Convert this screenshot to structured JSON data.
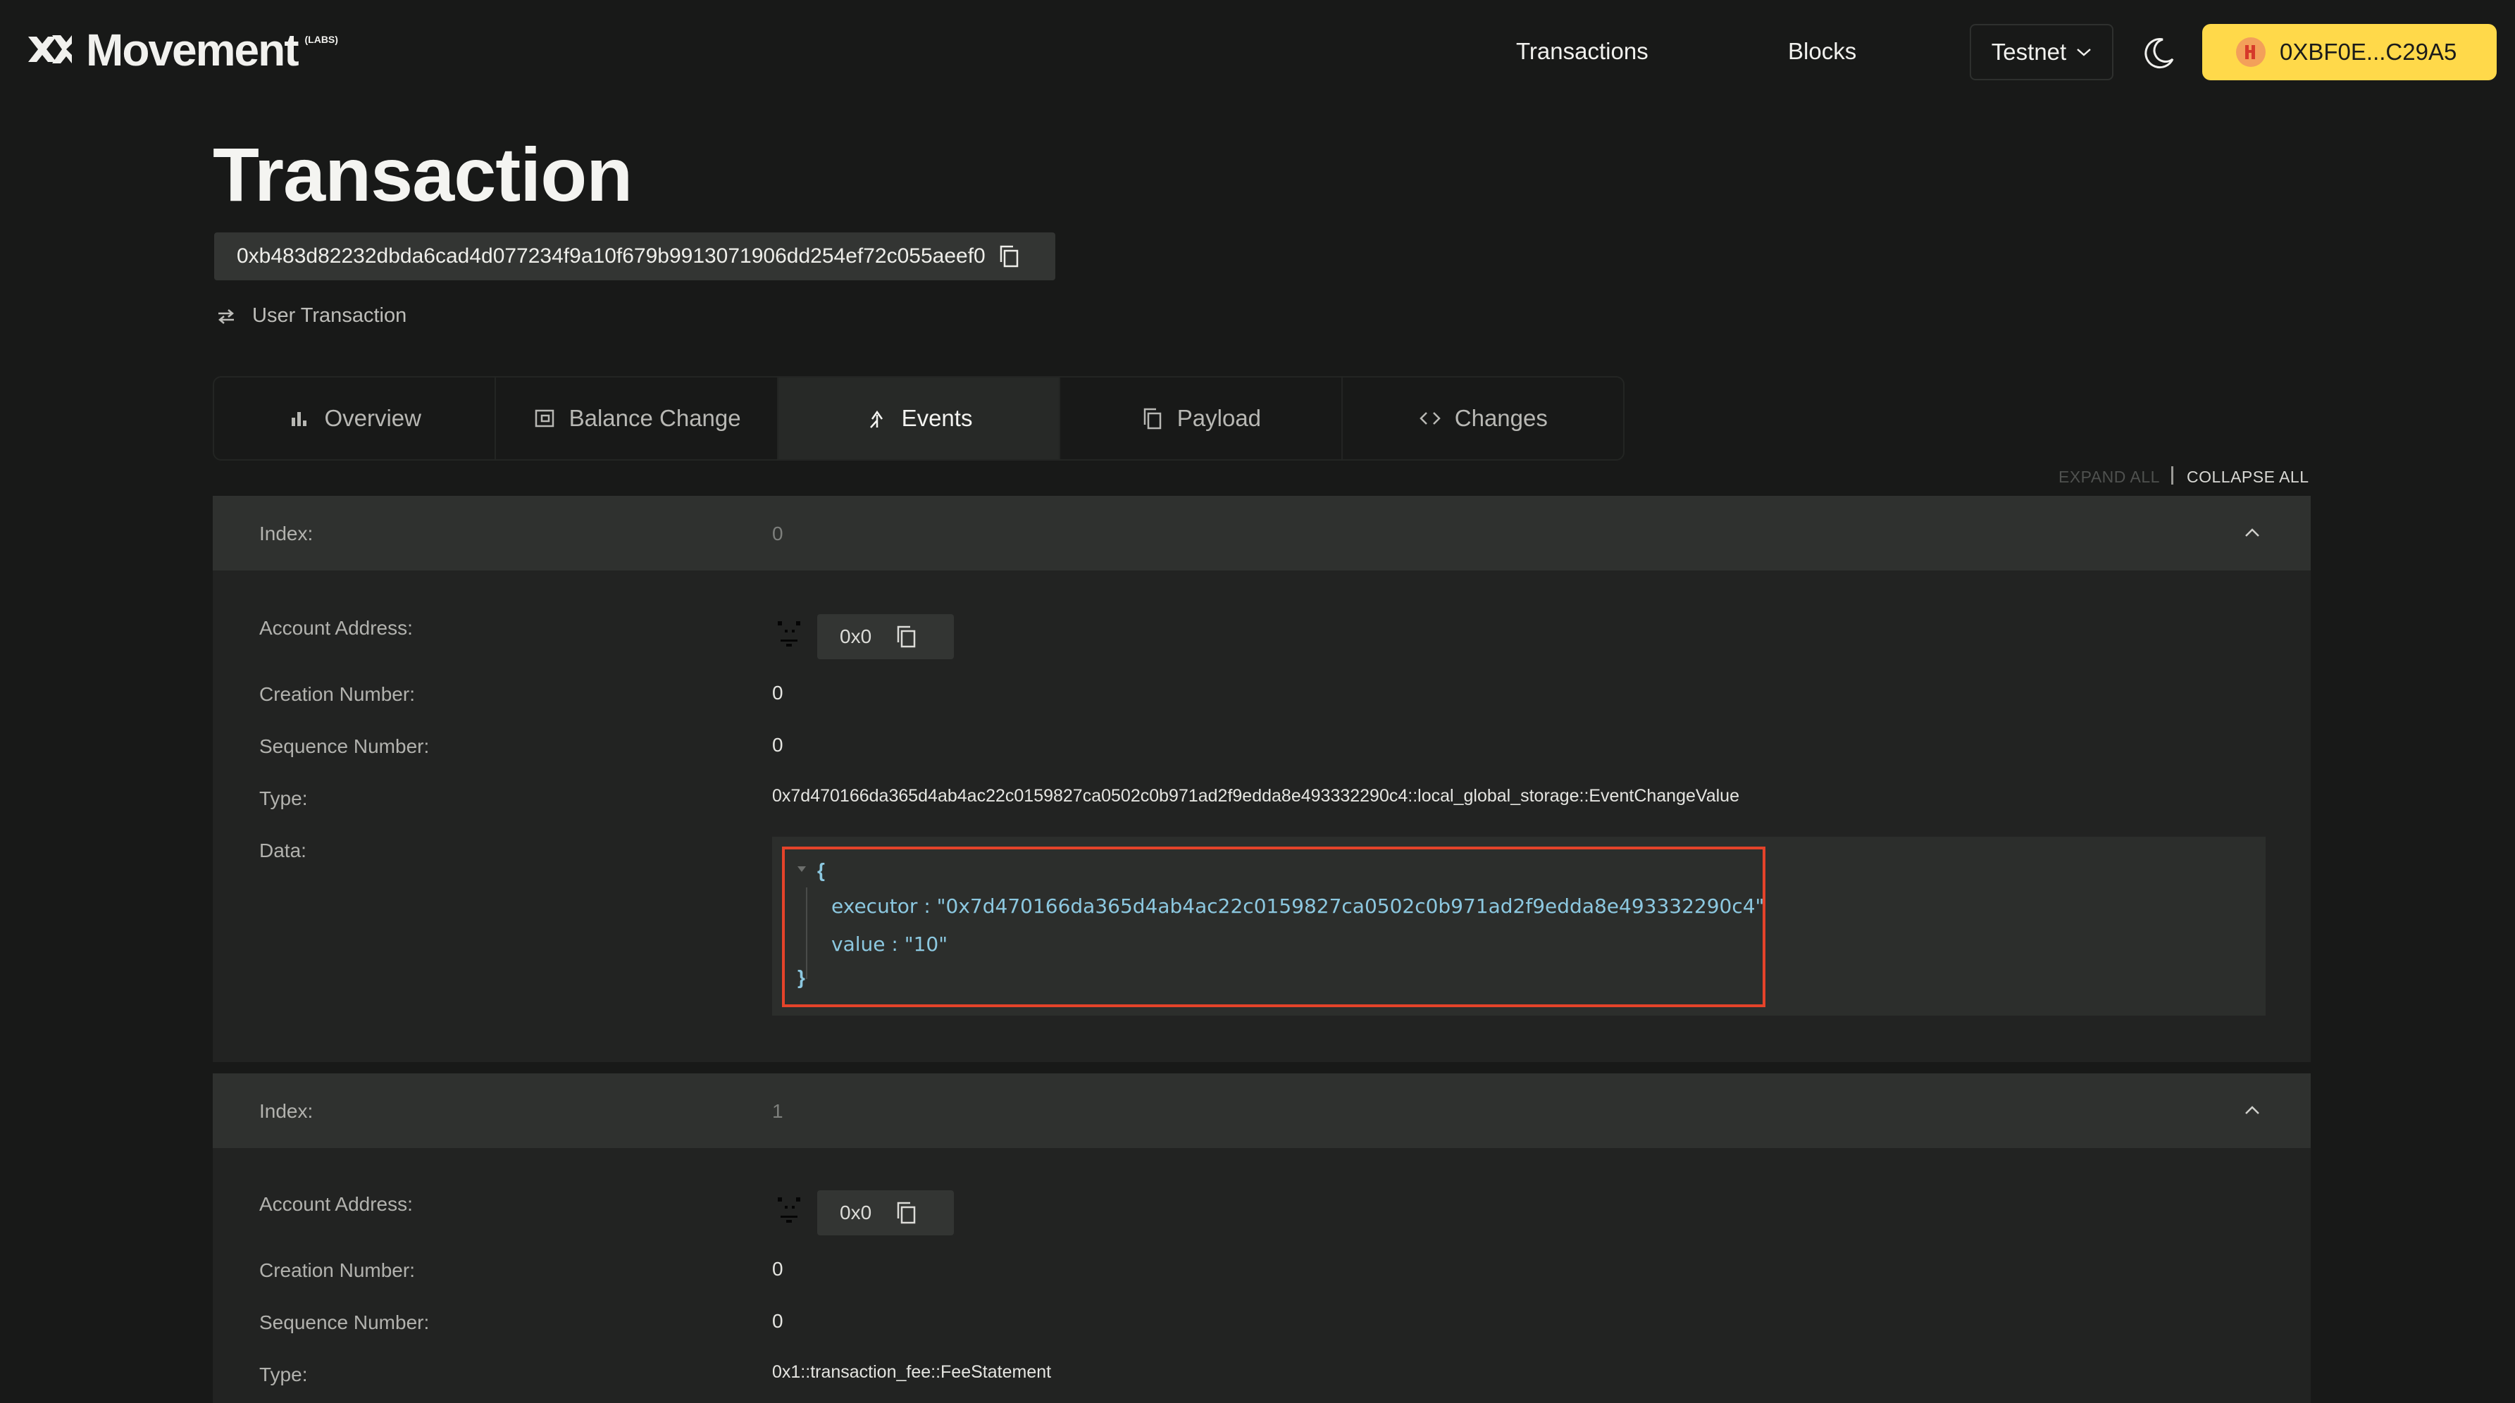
{
  "header": {
    "brand": "Movement",
    "brand_suffix": "(LABS)",
    "nav": [
      "Transactions",
      "Blocks"
    ],
    "network": "Testnet",
    "wallet_address": "0XBF0E...C29A5"
  },
  "page": {
    "title": "Transaction",
    "hash": "0xb483d82232dbda6cad4d077234f9a10f679b9913071906dd254ef72c055aeef0",
    "tx_type": "User Transaction"
  },
  "tabs": [
    {
      "label": "Overview",
      "icon": "bar-chart-icon"
    },
    {
      "label": "Balance Change",
      "icon": "wallet-icon"
    },
    {
      "label": "Events",
      "icon": "merge-icon"
    },
    {
      "label": "Payload",
      "icon": "copy-doc-icon"
    },
    {
      "label": "Changes",
      "icon": "code-icon"
    }
  ],
  "active_tab": "Events",
  "controls": {
    "expand_all": "EXPAND ALL",
    "collapse_all": "COLLAPSE ALL"
  },
  "labels": {
    "index": "Index:",
    "account_address": "Account Address:",
    "creation_number": "Creation Number:",
    "sequence_number": "Sequence Number:",
    "type": "Type:",
    "data": "Data:"
  },
  "events": [
    {
      "index": "0",
      "account_address": "0x0",
      "creation_number": "0",
      "sequence_number": "0",
      "type": "0x7d470166da365d4ab4ac22c0159827ca0502c0b971ad2f9edda8e493332290c4::local_global_storage::EventChangeValue",
      "data": {
        "open_brace": "{",
        "close_brace": "}",
        "executor_line": "executor : \"0x7d470166da365d4ab4ac22c0159827ca0502c0b971ad2f9edda8e493332290c4\"",
        "value_line": "value : \"10\""
      }
    },
    {
      "index": "1",
      "account_address": "0x0",
      "creation_number": "0",
      "sequence_number": "0",
      "type": "0x1::transaction_fee::FeeStatement"
    }
  ],
  "colors": {
    "background": "#181918",
    "accent": "#ffd94a",
    "highlight_border": "#e5432a",
    "json_text": "#8cc8e0"
  }
}
